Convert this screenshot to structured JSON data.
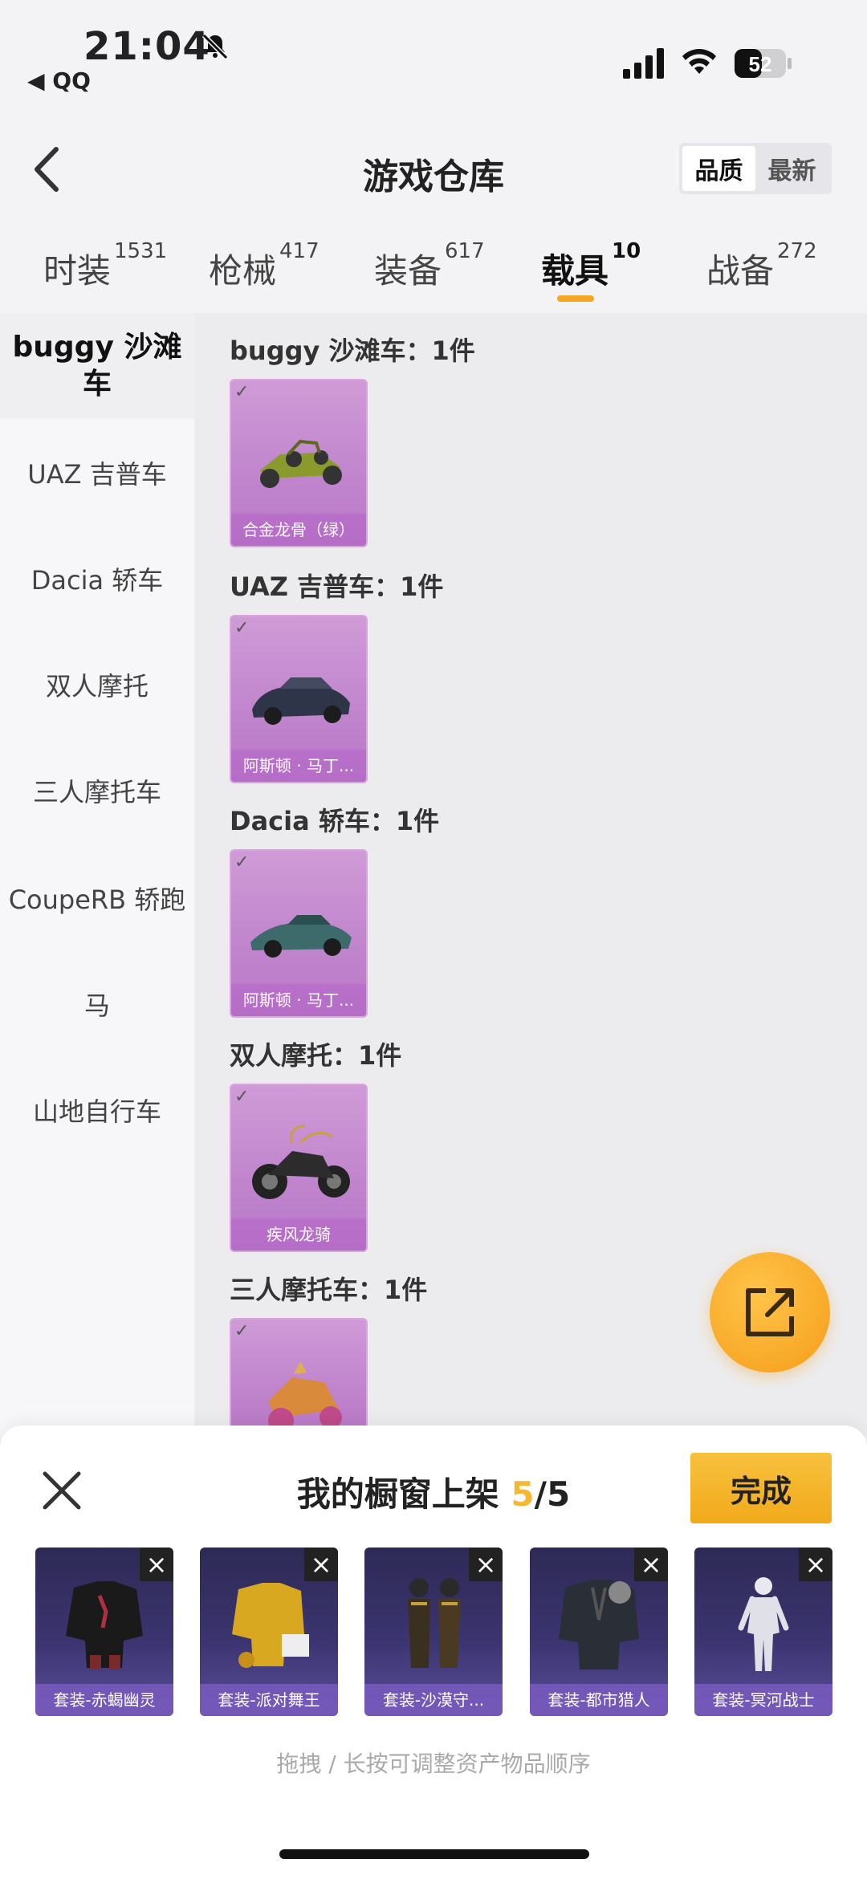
{
  "status_bar": {
    "time": "21:04",
    "back_app": "◀ QQ",
    "battery": "52"
  },
  "header": {
    "title": "游戏仓库",
    "sort_options": [
      "品质",
      "最新"
    ]
  },
  "tabs": [
    {
      "label": "时装",
      "count": "1531"
    },
    {
      "label": "枪械",
      "count": "417"
    },
    {
      "label": "装备",
      "count": "617"
    },
    {
      "label": "载具",
      "count": "10"
    },
    {
      "label": "战备",
      "count": "272"
    }
  ],
  "sidebar": {
    "items": [
      {
        "label": "buggy 沙滩车"
      },
      {
        "label": "UAZ 吉普车"
      },
      {
        "label": "Dacia 轿车"
      },
      {
        "label": "双人摩托"
      },
      {
        "label": "三人摩托车"
      },
      {
        "label": "CoupeRB 轿跑"
      },
      {
        "label": "马"
      },
      {
        "label": "山地自行车"
      }
    ]
  },
  "groups": [
    {
      "label": "buggy 沙滩车：1件",
      "item": "合金龙骨（绿）"
    },
    {
      "label": "UAZ 吉普车：1件",
      "item": "阿斯顿 · 马丁..."
    },
    {
      "label": "Dacia 轿车：1件",
      "item": "阿斯顿 · 马丁..."
    },
    {
      "label": "双人摩托：1件",
      "item": "疾风龙骑"
    },
    {
      "label": "三人摩托车：1件",
      "item": ""
    }
  ],
  "sheet": {
    "title": "我的橱窗上架",
    "count": "5",
    "total": "/5",
    "done": "完成",
    "items": [
      "套装-赤蝎幽灵",
      "套装-派对舞王",
      "套装-沙漠守...",
      "套装-都市猎人",
      "套装-冥河战士"
    ],
    "hint": "拖拽 / 长按可调整资产物品顺序"
  },
  "colors": {
    "accent": "#f5a623",
    "card_purple": "#c084cd",
    "shelf_navy": "#3b3470"
  }
}
